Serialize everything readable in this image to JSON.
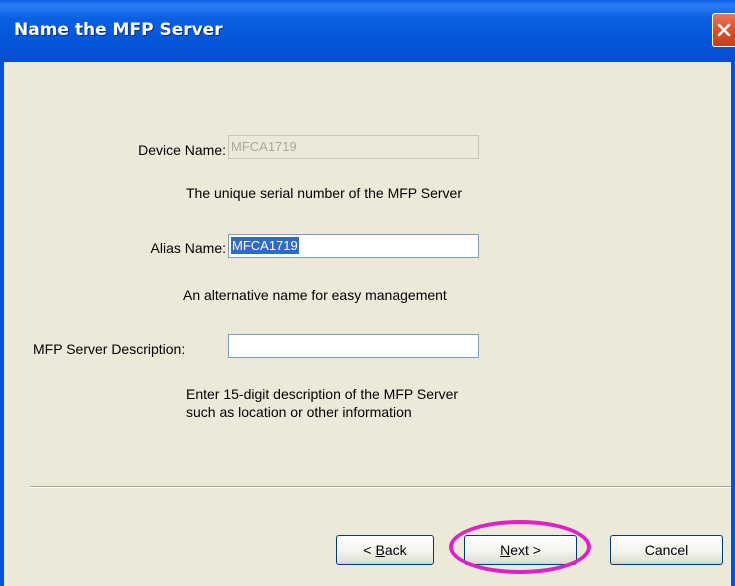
{
  "window": {
    "title": "Name the MFP Server"
  },
  "form": {
    "device_name": {
      "label": "Device Name:",
      "value": "MFCA1719",
      "hint": "The unique serial number of the MFP Server"
    },
    "alias_name": {
      "label": "Alias Name:",
      "value": "MFCA1719",
      "hint": "An alternative name for easy management"
    },
    "description": {
      "label": "MFP Server Description:",
      "value": "",
      "hint_line1": "Enter 15-digit description of the MFP Server",
      "hint_line2": "such as location or other information"
    }
  },
  "buttons": {
    "back_prefix": "< ",
    "back_accel": "B",
    "back_rest": "ack",
    "next_accel": "N",
    "next_rest": "ext >",
    "cancel": "Cancel"
  },
  "colors": {
    "title_bar": "#0054e3",
    "dialog_bg": "#ece9d8",
    "highlight_ring": "#e020c8",
    "selection": "#316ac5"
  }
}
